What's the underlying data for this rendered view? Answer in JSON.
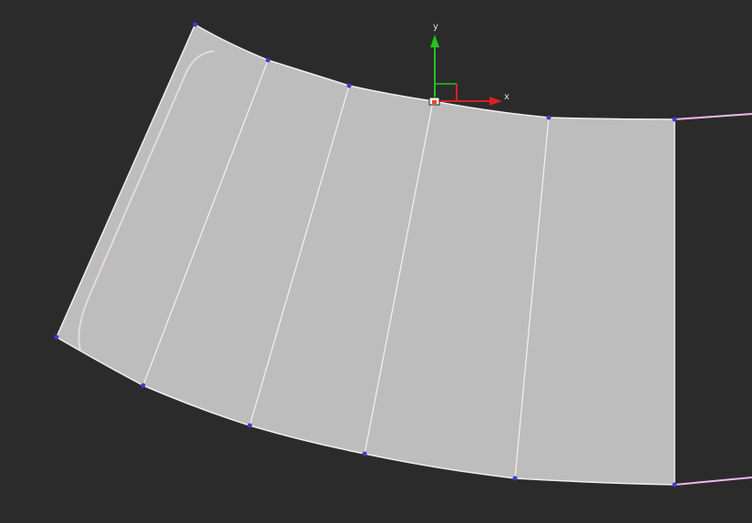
{
  "viewport": {
    "background": "#2b2b2b"
  },
  "mesh": {
    "fill_color": "#bdbdbd",
    "edge_color": "#f2f2f2",
    "selected_spline_color": "#f0b7f0",
    "vertex_color": "#3d3dcc",
    "segment_count": 5
  },
  "gizmo": {
    "x_axis_label": "x",
    "y_axis_label": "y",
    "x_axis_color": "#d92020",
    "y_axis_color": "#22c322",
    "center_box_color": "#f5f5f5",
    "pivot_marker_color": "#e34b1f"
  }
}
